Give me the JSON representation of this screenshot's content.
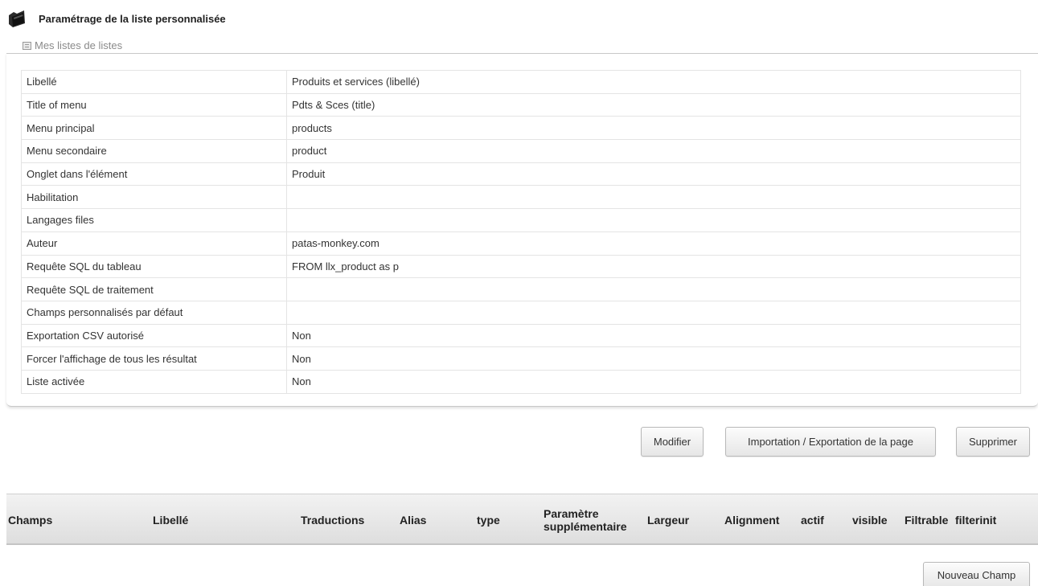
{
  "header": {
    "title": "Paramétrage de la liste personnalisée",
    "icon": "folder-icon"
  },
  "breadcrumb": {
    "icon": "list-icon",
    "label": "Mes listes de listes"
  },
  "properties": [
    {
      "label": "Libellé",
      "value": "Produits et services (libellé)"
    },
    {
      "label": "Title of menu",
      "value": "Pdts & Sces (title)"
    },
    {
      "label": "Menu principal",
      "value": "products"
    },
    {
      "label": "Menu secondaire",
      "value": "product"
    },
    {
      "label": "Onglet dans l'élément",
      "value": "Produit"
    },
    {
      "label": "Habilitation",
      "value": ""
    },
    {
      "label": "Langages files",
      "value": ""
    },
    {
      "label": "Auteur",
      "value": "patas-monkey.com"
    },
    {
      "label": "Requête SQL du tableau",
      "value": "FROM llx_product as p"
    },
    {
      "label": "Requête SQL de traitement",
      "value": ""
    },
    {
      "label": "Champs personnalisés par défaut",
      "value": ""
    },
    {
      "label": "Exportation CSV autorisé",
      "value": "Non"
    },
    {
      "label": "Forcer l'affichage de tous les résultat",
      "value": "Non"
    },
    {
      "label": "Liste activée",
      "value": "Non"
    }
  ],
  "actions": {
    "modify": "Modifier",
    "export": "Importation / Exportation de la page",
    "delete": "Supprimer"
  },
  "fields_table": {
    "columns": [
      "Champs",
      "Libellé",
      "Traductions",
      "Alias",
      "type",
      "Paramètre\nsupplémentaire",
      "Largeur",
      "Alignment",
      "actif",
      "visible",
      "Filtrable",
      "filterinit"
    ]
  },
  "new_field_label": "Nouveau Champ"
}
